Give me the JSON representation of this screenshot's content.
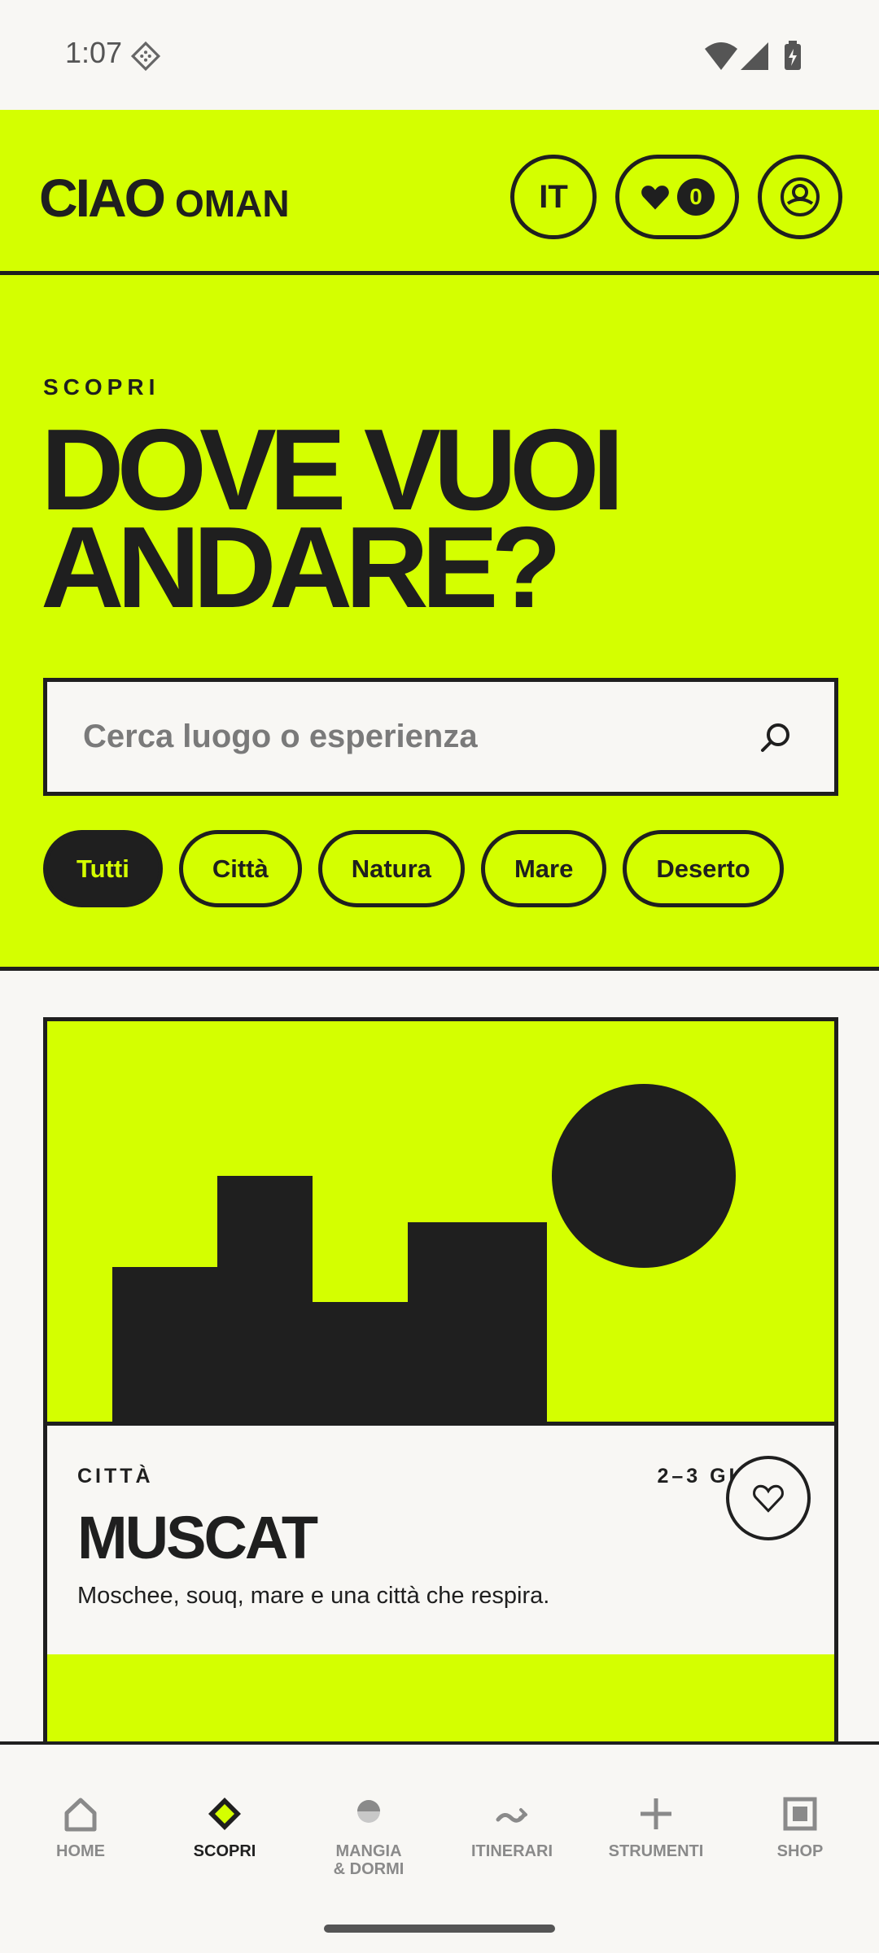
{
  "status_bar": {
    "time": "1:07"
  },
  "header": {
    "brand_primary": "CIAO",
    "brand_secondary": "OMAN",
    "language_button": "IT",
    "favorites_count": "0"
  },
  "hero": {
    "eyebrow": "SCOPRI",
    "title": "DOVE VUOI ANDARE?",
    "search_placeholder": "Cerca luogo o esperienza",
    "filters": [
      {
        "label": "Tutti",
        "active": true
      },
      {
        "label": "Città",
        "active": false
      },
      {
        "label": "Natura",
        "active": false
      },
      {
        "label": "Mare",
        "active": false
      },
      {
        "label": "Deserto",
        "active": false
      }
    ]
  },
  "card": {
    "category": "CITTÀ",
    "duration": "2–3 GIORNI",
    "title": "MUSCAT",
    "description": "Moschee, souq, mare e una città che respira."
  },
  "bottom_nav": {
    "items": [
      {
        "label": "HOME",
        "icon": "home-icon",
        "active": false
      },
      {
        "label": "SCOPRI",
        "icon": "diamond-icon",
        "active": true
      },
      {
        "label": "MANGIA\n& DORMI",
        "icon": "half-circle-icon",
        "active": false
      },
      {
        "label": "ITINERARI",
        "icon": "route-icon",
        "active": false
      },
      {
        "label": "STRUMENTI",
        "icon": "plus-icon",
        "active": false
      },
      {
        "label": "SHOP",
        "icon": "square-icon",
        "active": false
      }
    ]
  },
  "colors": {
    "accent": "#d4ff00",
    "ink": "#1f1f1f",
    "background": "#f8f7f4"
  }
}
